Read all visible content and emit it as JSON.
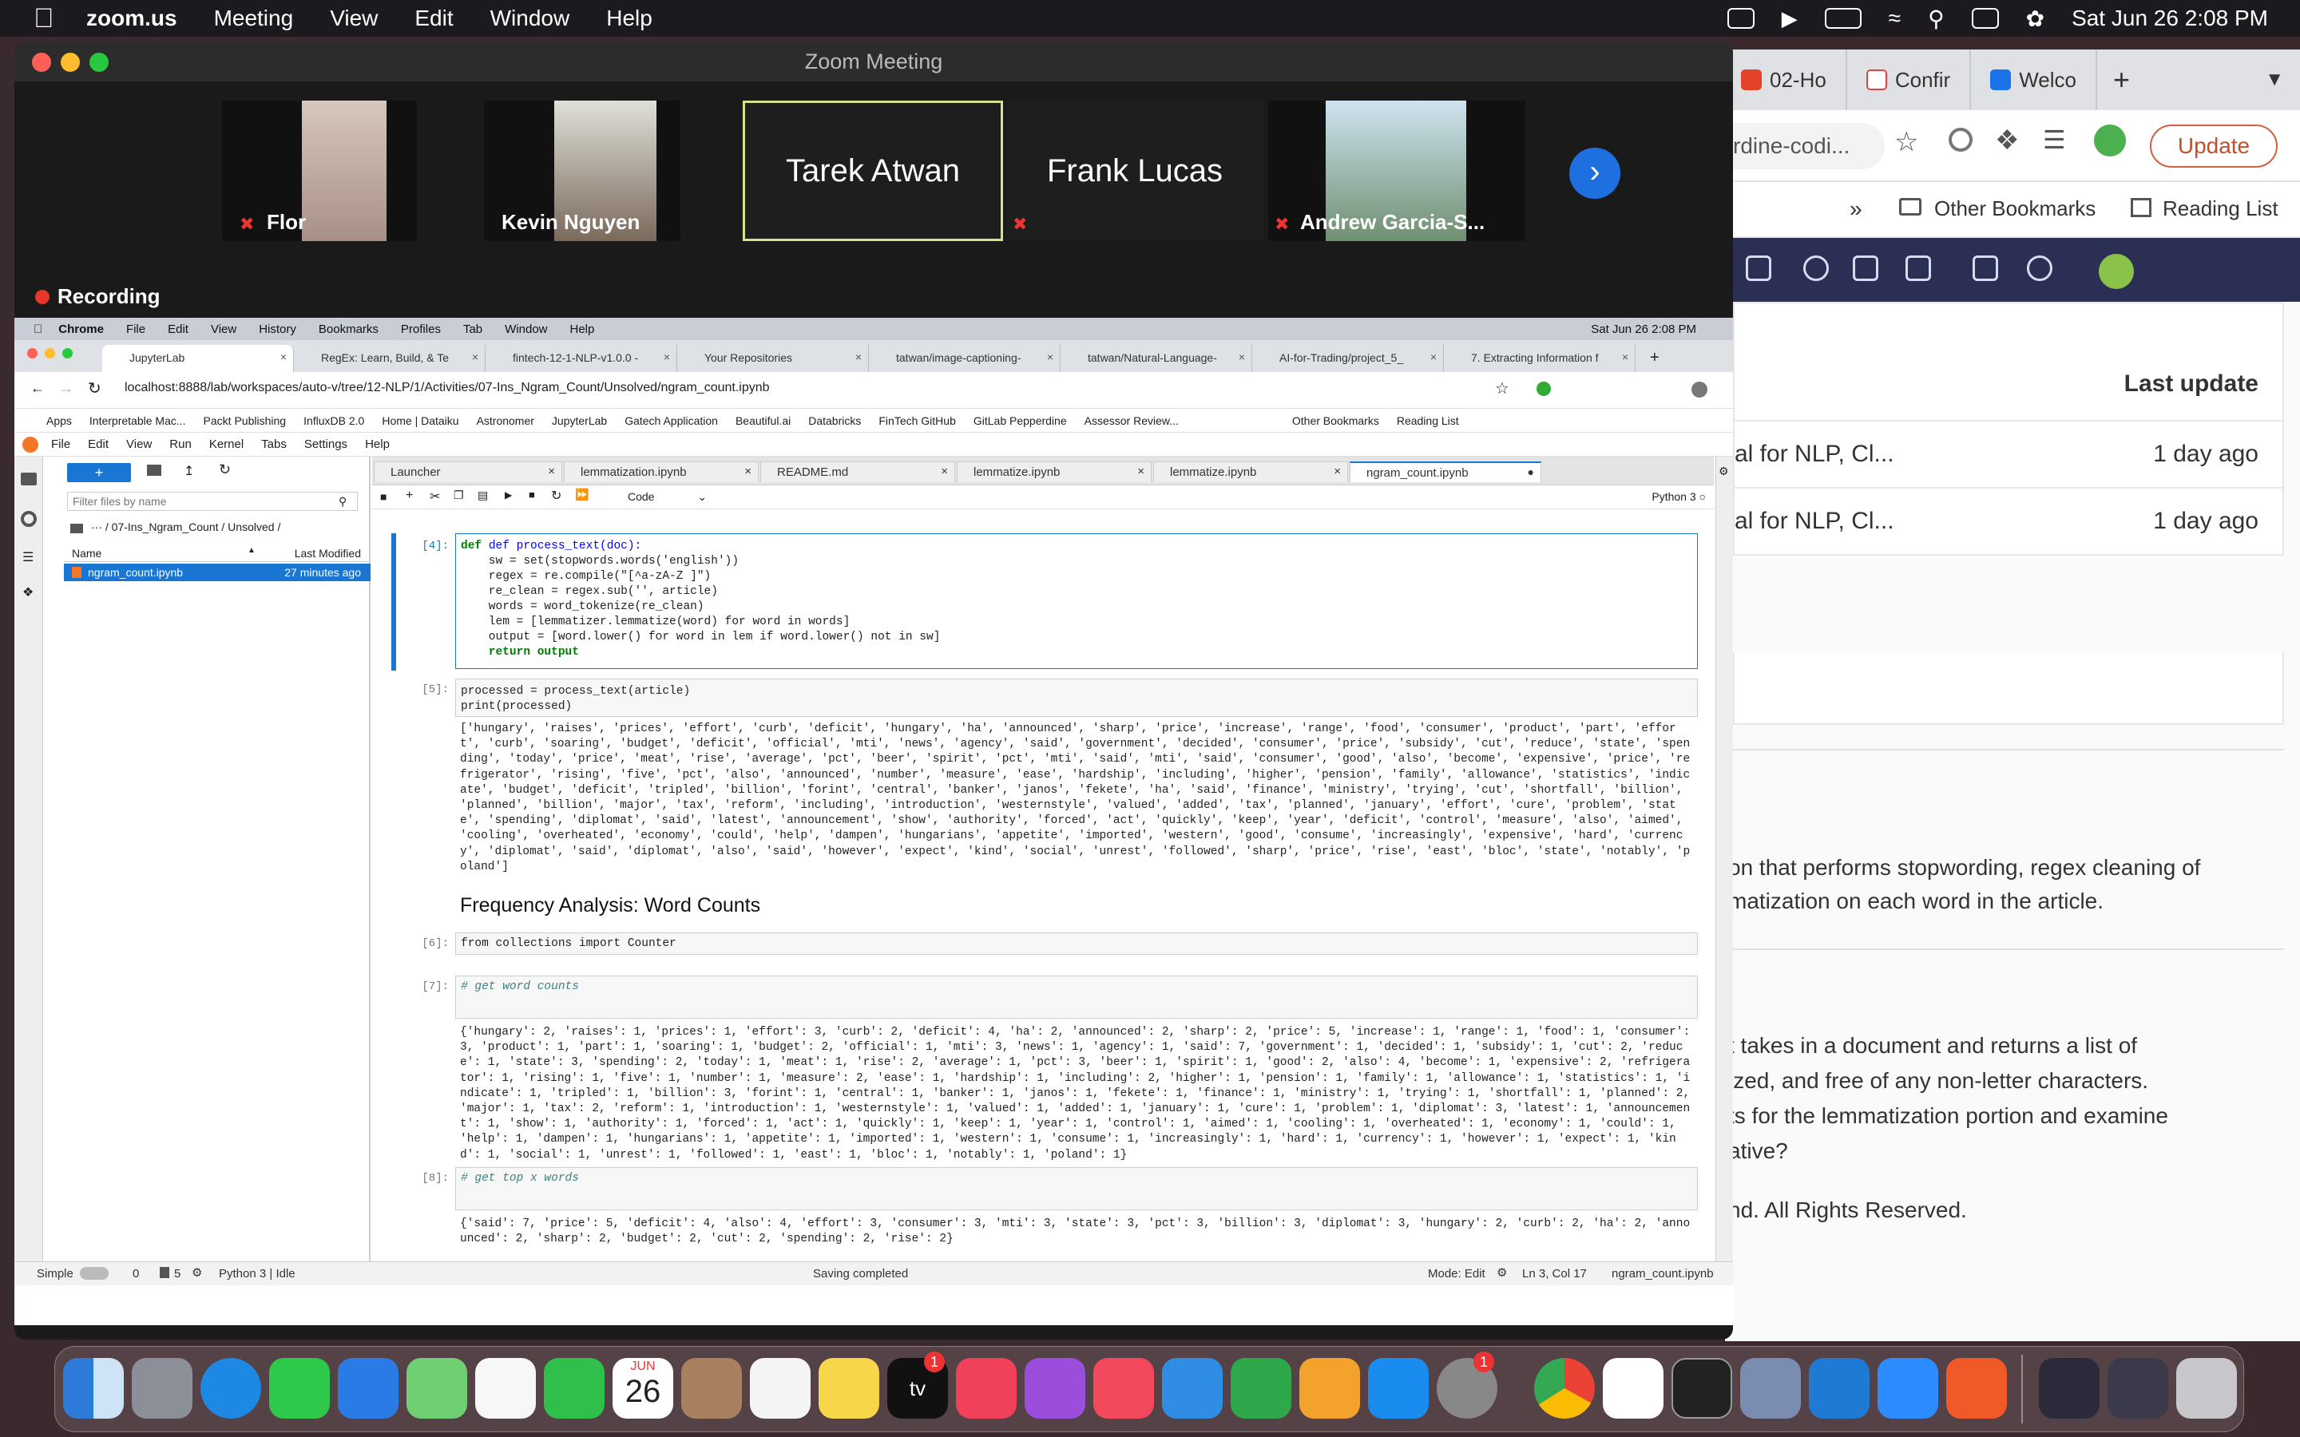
{
  "system_menu": {
    "app": "zoom.us",
    "items": [
      "Meeting",
      "View",
      "Edit",
      "Window",
      "Help"
    ],
    "datetime": "Sat Jun 26  2:08 PM"
  },
  "zoom": {
    "title": "Zoom Meeting",
    "participants": [
      {
        "name": "Flor",
        "muted": true,
        "has_video": true
      },
      {
        "name": "Kevin Nguyen",
        "muted": false,
        "has_video": true
      },
      {
        "name": "Tarek Atwan",
        "muted": false,
        "has_video": false,
        "active_speaker": true
      },
      {
        "name": "Frank Lucas",
        "muted": true,
        "has_video": false
      },
      {
        "name": "Andrew Garcia-S...",
        "muted": true,
        "has_video": true
      }
    ],
    "recording": "Recording"
  },
  "right_browser": {
    "tabs": [
      "02-Ho",
      "Confir",
      "Welco"
    ],
    "url_fragment": "rdine-codi...",
    "update_label": "Update",
    "bookmarks": [
      "Other Bookmarks",
      "Reading List"
    ],
    "table_header": "Last update",
    "rows": [
      {
        "name": "al for NLP, Cl...",
        "updated": "1 day ago"
      },
      {
        "name": "al for NLP, Cl...",
        "updated": "1 day ago"
      }
    ],
    "text1": "on that performs stopwording, regex cleaning of\nmatization on each word in the article.",
    "text2": "t takes in a document and returns a list of\nized, and free of any non-letter characters.\nts for the lemmatization portion and examine\native?",
    "footer": "nd. All Rights Reserved."
  },
  "shared": {
    "menu": [
      "Chrome",
      "File",
      "Edit",
      "View",
      "History",
      "Bookmarks",
      "Profiles",
      "Tab",
      "Window",
      "Help"
    ],
    "clock": "Sat Jun 26  2:08 PM",
    "tabs": [
      "JupyterLab",
      "RegEx: Learn, Build, & Te",
      "fintech-12-1-NLP-v1.0.0 -",
      "Your Repositories",
      "tatwan/image-captioning-",
      "tatwan/Natural-Language-",
      "AI-for-Trading/project_5_",
      "7. Extracting Information f"
    ],
    "url": "localhost:8888/lab/workspaces/auto-v/tree/12-NLP/1/Activities/07-Ins_Ngram_Count/Unsolved/ngram_count.ipynb",
    "bookmarks": [
      "Apps",
      "Interpretable Mac...",
      "Packt Publishing",
      "InfluxDB 2.0",
      "Home | Dataiku",
      "Astronomer",
      "JupyterLab",
      "Gatech Application",
      "Beautiful.ai",
      "Databricks",
      "FinTech GitHub",
      "GitLab Pepperdine",
      "Assessor Review...",
      "Other Bookmarks",
      "Reading List"
    ],
    "jupyter_menu": [
      "File",
      "Edit",
      "View",
      "Run",
      "Kernel",
      "Tabs",
      "Settings",
      "Help"
    ],
    "filebrowser": {
      "filter_placeholder": "Filter files by name",
      "path": "/ 07-Ins_Ngram_Count / Unsolved /",
      "col_name": "Name",
      "col_modified": "Last Modified",
      "file_name": "ngram_count.ipynb",
      "file_modified": "27 minutes ago"
    },
    "notebook_tabs": [
      "Launcher",
      "lemmatization.ipynb",
      "README.md",
      "lemmatize.ipynb",
      "lemmatize.ipynb",
      "ngram_count.ipynb"
    ],
    "cell_type": "Code",
    "kernel": "Python 3",
    "prompts": [
      "[4]:",
      "[5]:",
      "[6]:",
      "[7]:",
      "[8]:"
    ],
    "cell4": [
      "def process_text(doc):",
      "    sw = set(stopwords.words('english'))",
      "    regex = re.compile(\"[^a-zA-Z ]\")",
      "    re_clean = regex.sub('', article)",
      "    words = word_tokenize(re_clean)",
      "    lem = [lemmatizer.lemmatize(word) for word in words]",
      "    output = [word.lower() for word in lem if word.lower() not in sw]",
      "    return output"
    ],
    "cell5": [
      "processed = process_text(article)",
      "print(processed)"
    ],
    "out5": "['hungary', 'raises', 'prices', 'effort', 'curb', 'deficit', 'hungary', 'ha', 'announced', 'sharp', 'price', 'increase', 'range', 'food', 'consumer', 'product', 'part', 'effort', 'curb', 'soaring', 'budget', 'deficit', 'official', 'mti', 'news', 'agency', 'said', 'government', 'decided', 'consumer', 'price', 'subsidy', 'cut', 'reduce', 'state', 'spending', 'today', 'price', 'meat', 'rise', 'average', 'pct', 'beer', 'spirit', 'pct', 'mti', 'said', 'mti', 'said', 'consumer', 'good', 'also', 'become', 'expensive', 'price', 'refrigerator', 'rising', 'five', 'pct', 'also', 'announced', 'number', 'measure', 'ease', 'hardship', 'including', 'higher', 'pension', 'family', 'allowance', 'statistics', 'indicate', 'budget', 'deficit', 'tripled', 'billion', 'forint', 'central', 'banker', 'janos', 'fekete', 'ha', 'said', 'finance', 'ministry', 'trying', 'cut', 'shortfall', 'billion', 'planned', 'billion', 'major', 'tax', 'reform', 'including', 'introduction', 'westernstyle', 'valued', 'added', 'tax', 'planned', 'january', 'effort', 'cure', 'problem', 'state', 'spending', 'diplomat', 'said', 'latest', 'announcement', 'show', 'authority', 'forced', 'act', 'quickly', 'keep', 'year', 'deficit', 'control', 'measure', 'also', 'aimed', 'cooling', 'overheated', 'economy', 'could', 'help', 'dampen', 'hungarians', 'appetite', 'imported', 'western', 'good', 'consume', 'increasingly', 'expensive', 'hard', 'currency', 'diplomat', 'said', 'diplomat', 'also', 'said', 'however', 'expect', 'kind', 'social', 'unrest', 'followed', 'sharp', 'price', 'rise', 'east', 'bloc', 'state', 'notably', 'poland']",
    "heading": "Frequency Analysis: Word Counts",
    "cell6": "from collections import Counter",
    "cell7": "# get word counts",
    "out7": "{'hungary': 2, 'raises': 1, 'prices': 1, 'effort': 3, 'curb': 2, 'deficit': 4, 'ha': 2, 'announced': 2, 'sharp': 2, 'price': 5, 'increase': 1, 'range': 1, 'food': 1, 'consumer': 3, 'product': 1, 'part': 1, 'soaring': 1, 'budget': 2, 'official': 1, 'mti': 3, 'news': 1, 'agency': 1, 'said': 7, 'government': 1, 'decided': 1, 'subsidy': 1, 'cut': 2, 'reduce': 1, 'state': 3, 'spending': 2, 'today': 1, 'meat': 1, 'rise': 2, 'average': 1, 'pct': 3, 'beer': 1, 'spirit': 1, 'good': 2, 'also': 4, 'become': 1, 'expensive': 2, 'refrigerator': 1, 'rising': 1, 'five': 1, 'number': 1, 'measure': 2, 'ease': 1, 'hardship': 1, 'including': 2, 'higher': 1, 'pension': 1, 'family': 1, 'allowance': 1, 'statistics': 1, 'indicate': 1, 'tripled': 1, 'billion': 3, 'forint': 1, 'central': 1, 'banker': 1, 'janos': 1, 'fekete': 1, 'finance': 1, 'ministry': 1, 'trying': 1, 'shortfall': 1, 'planned': 2, 'major': 1, 'tax': 2, 'reform': 1, 'introduction': 1, 'westernstyle': 1, 'valued': 1, 'added': 1, 'january': 1, 'cure': 1, 'problem': 1, 'diplomat': 3, 'latest': 1, 'announcement': 1, 'show': 1, 'authority': 1, 'forced': 1, 'act': 1, 'quickly': 1, 'keep': 1, 'year': 1, 'control': 1, 'aimed': 1, 'cooling': 1, 'overheated': 1, 'economy': 1, 'could': 1, 'help': 1, 'dampen': 1, 'hungarians': 1, 'appetite': 1, 'imported': 1, 'western': 1, 'consume': 1, 'increasingly': 1, 'hard': 1, 'currency': 1, 'however': 1, 'expect': 1, 'kind': 1, 'social': 1, 'unrest': 1, 'followed': 1, 'east': 1, 'bloc': 1, 'notably': 1, 'poland': 1}",
    "cell8": "# get top x words",
    "out8": "{'said': 7, 'price': 5, 'deficit': 4, 'also': 4, 'effort': 3, 'consumer': 3, 'mti': 3, 'state': 3, 'pct': 3, 'billion': 3, 'diplomat': 3, 'hungary': 2, 'curb': 2, 'ha': 2, 'announced': 2, 'sharp': 2, 'budget': 2, 'cut': 2, 'spending': 2, 'rise': 2}",
    "status": {
      "mode_toggle": "Simple",
      "counts": "0",
      "counts2": "5",
      "kernel_status": "Python 3 | Idle",
      "save": "Saving completed",
      "mode": "Mode: Edit",
      "cursor": "Ln 3, Col 17",
      "file": "ngram_count.ipynb"
    }
  },
  "dock": {
    "calendar_month": "JUN",
    "calendar_day": "26",
    "tv_badge": "1",
    "settings_badge": "1"
  },
  "colors": {
    "zoom_active": "#d8e08a",
    "jupyter_blue": "#1976d2",
    "rec_red": "#e8372a"
  }
}
